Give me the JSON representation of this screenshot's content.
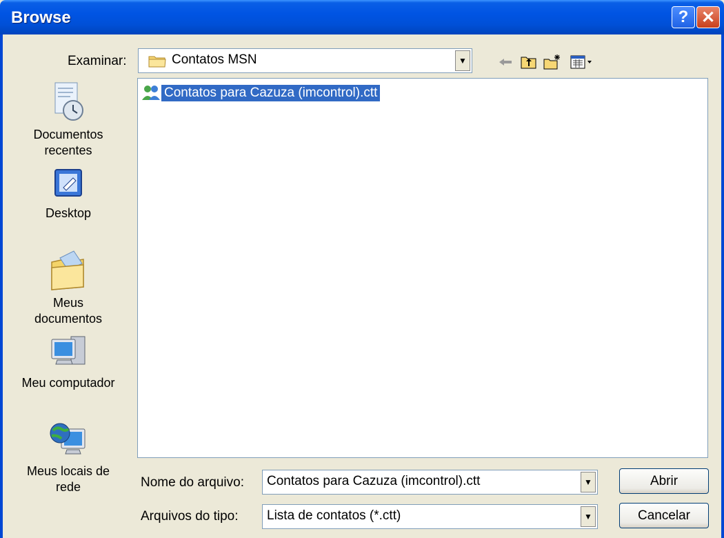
{
  "window": {
    "title": "Browse"
  },
  "title_buttons": {
    "help": "?",
    "close": "✕"
  },
  "lookin": {
    "label": "Examinar:",
    "value": "Contatos MSN"
  },
  "places": [
    {
      "label_line1": "Documentos",
      "label_line2": "recentes"
    },
    {
      "label_line1": "Desktop",
      "label_line2": ""
    },
    {
      "label_line1": "Meus",
      "label_line2": "documentos"
    },
    {
      "label_line1": "Meu computador",
      "label_line2": ""
    },
    {
      "label_line1": "Meus locais de",
      "label_line2": "rede"
    }
  ],
  "files": [
    {
      "name": "Contatos para Cazuza (imcontrol).ctt",
      "selected": true
    }
  ],
  "filename": {
    "label": "Nome do arquivo:",
    "value": "Contatos para Cazuza (imcontrol).ctt"
  },
  "filetype": {
    "label": "Arquivos do tipo:",
    "value": "Lista de contatos (*.ctt)"
  },
  "buttons": {
    "open": "Abrir",
    "cancel": "Cancelar"
  },
  "colors": {
    "selection": "#316ac5",
    "titlebar": "#0054e3",
    "dialog_bg": "#ece9d8"
  }
}
